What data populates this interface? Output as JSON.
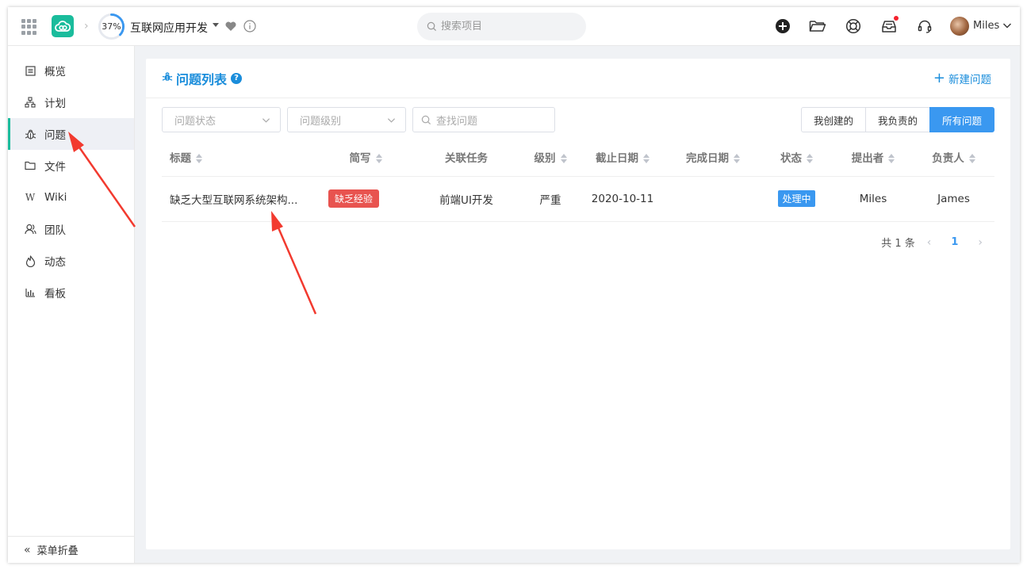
{
  "topbar": {
    "progress": "37%",
    "progress_fraction": 0.37,
    "project_name": "互联网应用开发",
    "search_placeholder": "搜索项目",
    "user_name": "Miles"
  },
  "sidebar": {
    "items": [
      {
        "label": "概览",
        "icon": "overview-icon"
      },
      {
        "label": "计划",
        "icon": "plan-icon"
      },
      {
        "label": "问题",
        "icon": "bug-icon"
      },
      {
        "label": "文件",
        "icon": "folder-icon"
      },
      {
        "label": "Wiki",
        "icon": "wiki-icon"
      },
      {
        "label": "团队",
        "icon": "team-icon"
      },
      {
        "label": "动态",
        "icon": "activity-icon"
      },
      {
        "label": "看板",
        "icon": "board-icon"
      }
    ],
    "active_index": 2,
    "collapse_label": "菜单折叠"
  },
  "panel": {
    "title": "问题列表",
    "new_issue_label": "新建问题",
    "filters": {
      "status_placeholder": "问题状态",
      "level_placeholder": "问题级别",
      "search_placeholder": "查找问题"
    },
    "segments": [
      "我创建的",
      "我负责的",
      "所有问题"
    ],
    "active_segment": "所有问题",
    "columns": [
      "标题",
      "简写",
      "关联任务",
      "级别",
      "截止日期",
      "完成日期",
      "状态",
      "提出者",
      "负责人"
    ],
    "rows": [
      {
        "title": "缺乏大型互联网系统架构...",
        "short": "缺乏经验",
        "task": "前端UI开发",
        "level": "严重",
        "deadline": "2020-10-11",
        "finish": "",
        "status": "处理中",
        "creator": "Miles",
        "owner": "James"
      }
    ],
    "pagination": {
      "total_label": "共 1 条",
      "current_page": "1"
    }
  },
  "colors": {
    "brand": "#1abc9c",
    "accent_blue": "#3a98f0",
    "tag_red": "#e8534f",
    "annotation_arrow": "#f23a2f"
  }
}
